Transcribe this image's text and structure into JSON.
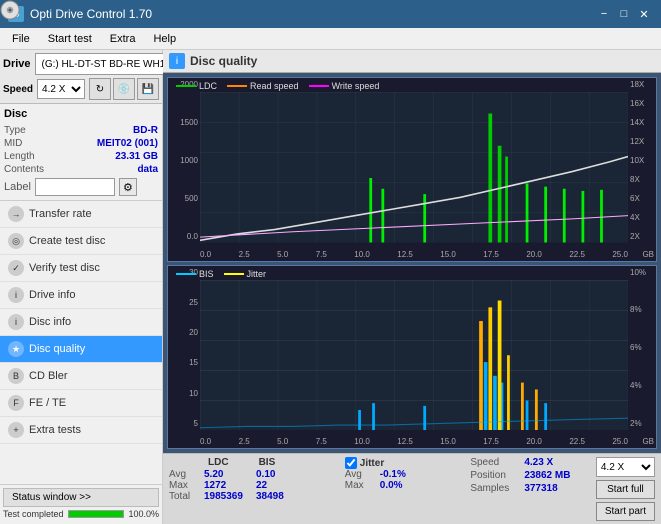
{
  "titleBar": {
    "title": "Opti Drive Control 1.70",
    "minLabel": "−",
    "maxLabel": "□",
    "closeLabel": "✕"
  },
  "menuBar": {
    "items": [
      "File",
      "Start test",
      "Extra",
      "Help"
    ]
  },
  "drive": {
    "label": "Drive",
    "driveValue": "(G:)  HL-DT-ST BD-RE  WH16NS48 1.D3",
    "speedLabel": "Speed",
    "speedValue": "4.2 X"
  },
  "disc": {
    "sectionTitle": "Disc",
    "typeLabel": "Type",
    "typeValue": "BD-R",
    "midLabel": "MID",
    "midValue": "MEIT02 (001)",
    "lengthLabel": "Length",
    "lengthValue": "23.31 GB",
    "contentsLabel": "Contents",
    "contentsValue": "data",
    "labelLabel": "Label",
    "labelValue": ""
  },
  "sidebarItems": [
    {
      "id": "transfer-rate",
      "label": "Transfer rate",
      "icon": "→"
    },
    {
      "id": "create-test-disc",
      "label": "Create test disc",
      "icon": "◎"
    },
    {
      "id": "verify-test-disc",
      "label": "Verify test disc",
      "icon": "✓"
    },
    {
      "id": "drive-info",
      "label": "Drive info",
      "icon": "i"
    },
    {
      "id": "disc-info",
      "label": "Disc info",
      "icon": "i"
    },
    {
      "id": "disc-quality",
      "label": "Disc quality",
      "icon": "★",
      "active": true
    },
    {
      "id": "cd-bler",
      "label": "CD Bler",
      "icon": "B"
    },
    {
      "id": "fe-te",
      "label": "FE / TE",
      "icon": "F"
    },
    {
      "id": "extra-tests",
      "label": "Extra tests",
      "icon": "+"
    }
  ],
  "statusBar": {
    "windowBtn": "Status window >>",
    "statusText": "Test completed",
    "progressPct": 100
  },
  "discQuality": {
    "title": "Disc quality",
    "iconLabel": "i",
    "chart1Legend": {
      "ldc": "LDC",
      "readSpeed": "Read speed",
      "writeSpeed": "Write speed"
    },
    "chart1YLeft": [
      "2000",
      "1500",
      "1000",
      "500",
      "0.0"
    ],
    "chart1YRight": [
      "18X",
      "16X",
      "14X",
      "12X",
      "10X",
      "8X",
      "6X",
      "4X",
      "2X"
    ],
    "chart1XAxis": [
      "0.0",
      "2.5",
      "5.0",
      "7.5",
      "10.0",
      "12.5",
      "15.0",
      "17.5",
      "20.0",
      "22.5",
      "25.0"
    ],
    "chart2Legend": {
      "bis": "BIS",
      "jitter": "Jitter"
    },
    "chart2YLeft": [
      "30",
      "25",
      "20",
      "15",
      "10",
      "5"
    ],
    "chart2YRight": [
      "10%",
      "8%",
      "6%",
      "4%",
      "2%"
    ],
    "chart2XAxis": [
      "0.0",
      "2.5",
      "5.0",
      "7.5",
      "10.0",
      "12.5",
      "15.0",
      "17.5",
      "20.0",
      "22.5",
      "25.0"
    ],
    "gbLabel": "GB"
  },
  "stats": {
    "ldcHeader": "LDC",
    "bisHeader": "BIS",
    "avgLabel": "Avg",
    "maxLabel": "Max",
    "totalLabel": "Total",
    "ldcAvg": "5.20",
    "ldcMax": "1272",
    "ldcTotal": "1985369",
    "bisAvg": "0.10",
    "bisMax": "22",
    "bisTotal": "38498",
    "jitterChecked": true,
    "jitterLabel": "Jitter",
    "jitterAvg": "-0.1%",
    "jitterMax": "0.0%",
    "speedLabel": "Speed",
    "speedVal": "4.23 X",
    "positionLabel": "Position",
    "positionVal": "23862 MB",
    "samplesLabel": "Samples",
    "samplesVal": "377318",
    "speedSelectVal": "4.2 X",
    "startFullLabel": "Start full",
    "startPartLabel": "Start part"
  }
}
